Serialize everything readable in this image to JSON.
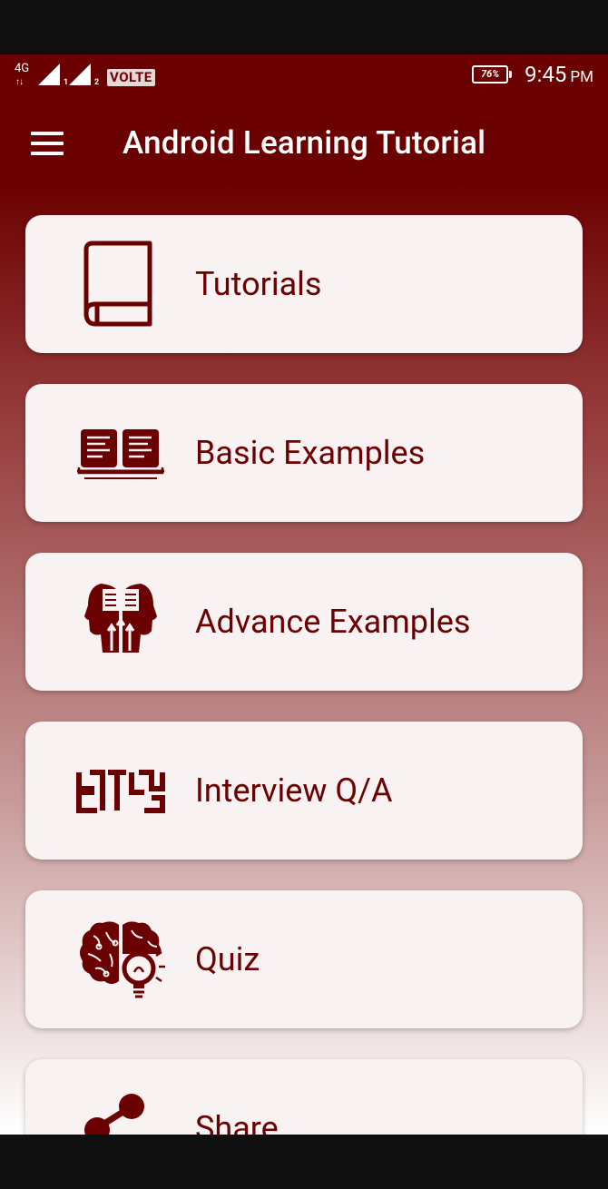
{
  "status_bar": {
    "network_type": "4G",
    "network_activity": "↑↓",
    "sim1": "1",
    "sim2": "2",
    "volte": "VOLTE",
    "battery": "76%",
    "time": "9:45",
    "ampm": "PM"
  },
  "toolbar": {
    "title": "Android Learning Tutorial"
  },
  "menu": [
    {
      "label": "Tutorials",
      "icon": "book-icon"
    },
    {
      "label": "Basic Examples",
      "icon": "open-book-laptop-icon"
    },
    {
      "label": "Advance Examples",
      "icon": "heads-book-icon"
    },
    {
      "label": "Interview Q/A",
      "icon": "pattern-icon"
    },
    {
      "label": "Quiz",
      "icon": "brain-bulb-icon"
    },
    {
      "label": "Share",
      "icon": "share-icon"
    }
  ],
  "colors": {
    "primary": "#6b0000",
    "card_background": "#f9f2f2"
  }
}
